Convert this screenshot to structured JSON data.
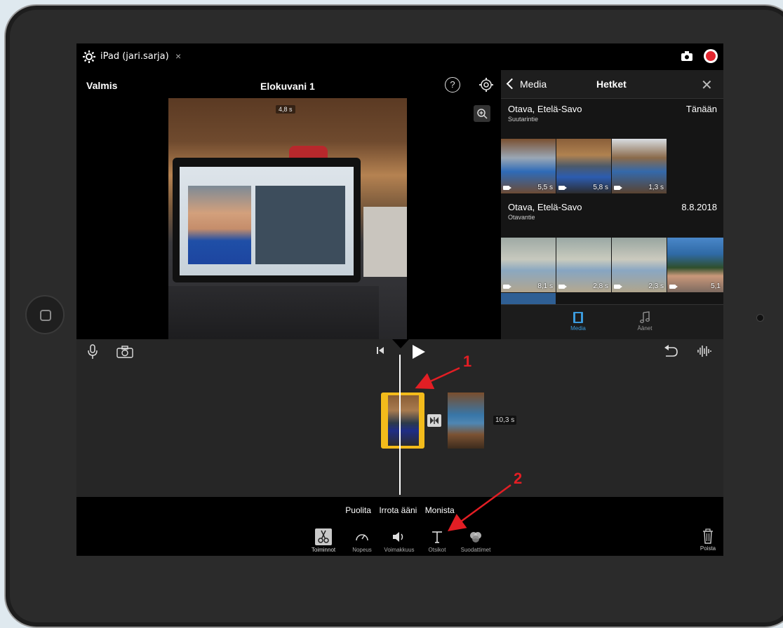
{
  "titlebar": {
    "title": "iPad (jari.sarja)",
    "close_glyph": "×",
    "icons": [
      "gear-icon",
      "camera-icon",
      "record-icon"
    ]
  },
  "viewer": {
    "done_label": "Valmis",
    "project_title": "Elokuvani 1",
    "help_glyph": "?",
    "clip_duration": "4,8 s"
  },
  "browser": {
    "back_label": "Media",
    "title": "Hetket",
    "moments": [
      {
        "place": "Otava, Etelä-Savo",
        "street": "Suutarintie",
        "date": "Tänään",
        "thumbs": [
          {
            "duration": "5,5 s"
          },
          {
            "duration": "5,8 s"
          },
          {
            "duration": "1,3 s"
          }
        ]
      },
      {
        "place": "Otava, Etelä-Savo",
        "street": "Otavantie",
        "date": "8.8.2018",
        "thumbs": [
          {
            "duration": "8,1 s"
          },
          {
            "duration": "2,8 s"
          },
          {
            "duration": "2,3 s"
          },
          {
            "duration": "5,1"
          }
        ]
      }
    ],
    "tabs": [
      {
        "label": "Media",
        "selected": true
      },
      {
        "label": "Äänet",
        "selected": false
      }
    ],
    "accent_color": "#3c9bdc"
  },
  "timeline": {
    "second_clip_duration": "10,3 s",
    "selected_clip_border_color": "#f3bb1b"
  },
  "toolbar": {
    "actions": [
      "Puolita",
      "Irrota ääni",
      "Monista"
    ],
    "tools": [
      {
        "label": "Toiminnot",
        "icon": "scissors-icon"
      },
      {
        "label": "Nopeus",
        "icon": "speedometer-icon"
      },
      {
        "label": "Voimakkuus",
        "icon": "speaker-icon"
      },
      {
        "label": "Otsikot",
        "icon": "text-title-icon"
      },
      {
        "label": "Suodattimet",
        "icon": "filters-icon"
      }
    ],
    "delete_label": "Poista"
  },
  "annotations": {
    "marker_1": "1",
    "marker_2": "2",
    "color": "#e31e24"
  }
}
